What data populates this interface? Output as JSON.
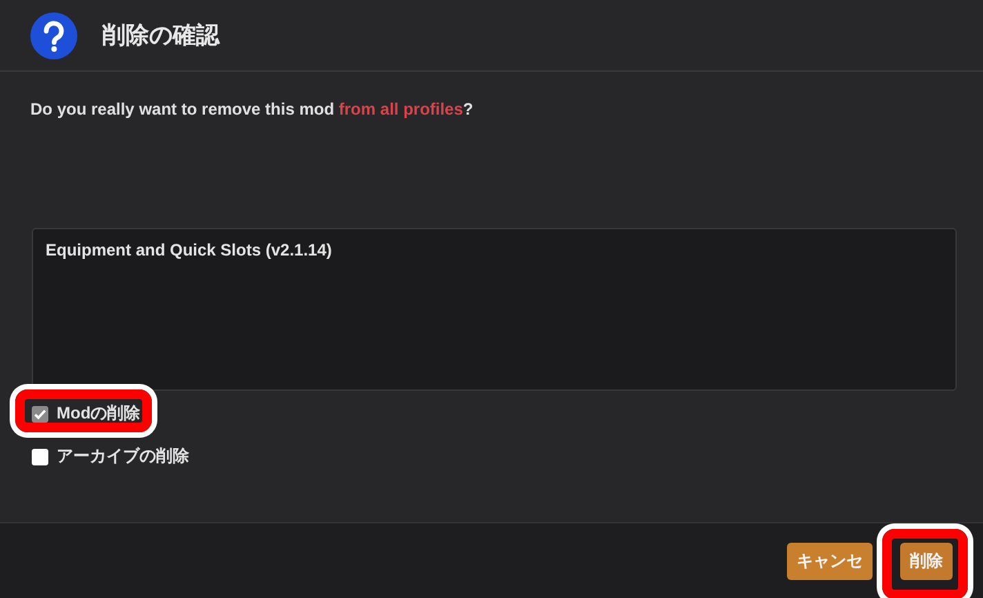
{
  "dialog": {
    "title": "削除の確認",
    "message": {
      "text": "Do you really want to remove this mod ",
      "emphasis": "from all profiles",
      "suffix": "?"
    },
    "mod_list": "Equipment and Quick Slots (v2.1.14)",
    "options": [
      {
        "label": "Modの削除",
        "checked": true,
        "highlighted": true
      },
      {
        "label": "アーカイブの削除",
        "checked": false,
        "highlighted": false
      }
    ],
    "buttons": [
      {
        "label": "キャンセ",
        "kind": "secondary",
        "highlighted": false
      },
      {
        "label": "削除",
        "kind": "primary",
        "highlighted": true
      }
    ]
  }
}
